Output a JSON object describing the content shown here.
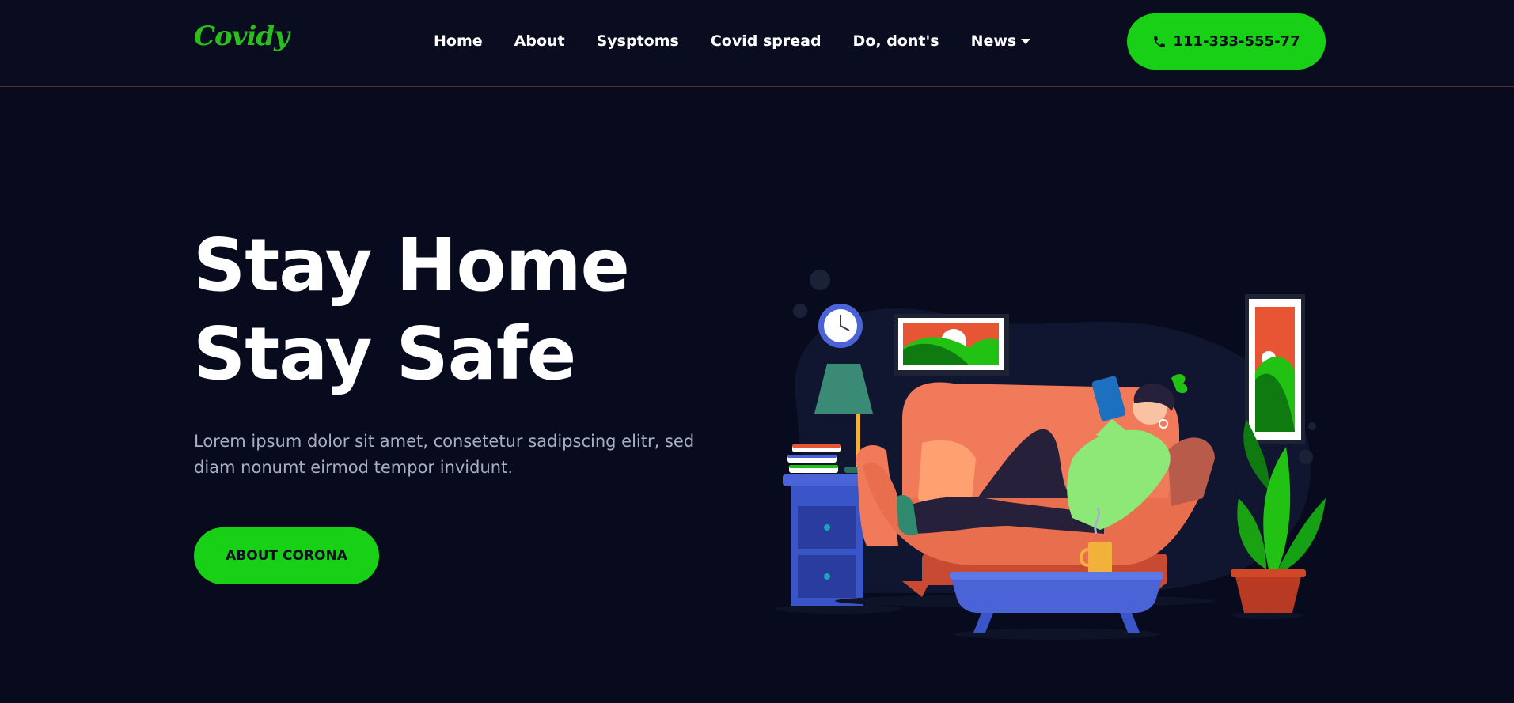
{
  "brand": {
    "logo": "Covidy"
  },
  "nav": {
    "items": [
      {
        "label": "Home"
      },
      {
        "label": "About"
      },
      {
        "label": "Sysptoms"
      },
      {
        "label": "Covid spread"
      },
      {
        "label": "Do, dont's"
      },
      {
        "label": "News"
      }
    ]
  },
  "header": {
    "phone": "111-333-555-77"
  },
  "hero": {
    "title": "Stay Home Stay Safe",
    "text": "Lorem ipsum dolor sit amet, consetetur sadipscing elitr, sed diam nonumt eirmod tempor invidunt.",
    "cta": "ABOUT CORONA"
  },
  "colors": {
    "background": "#070b1d",
    "accent": "#18d116",
    "muted_text": "#a9aec4"
  }
}
